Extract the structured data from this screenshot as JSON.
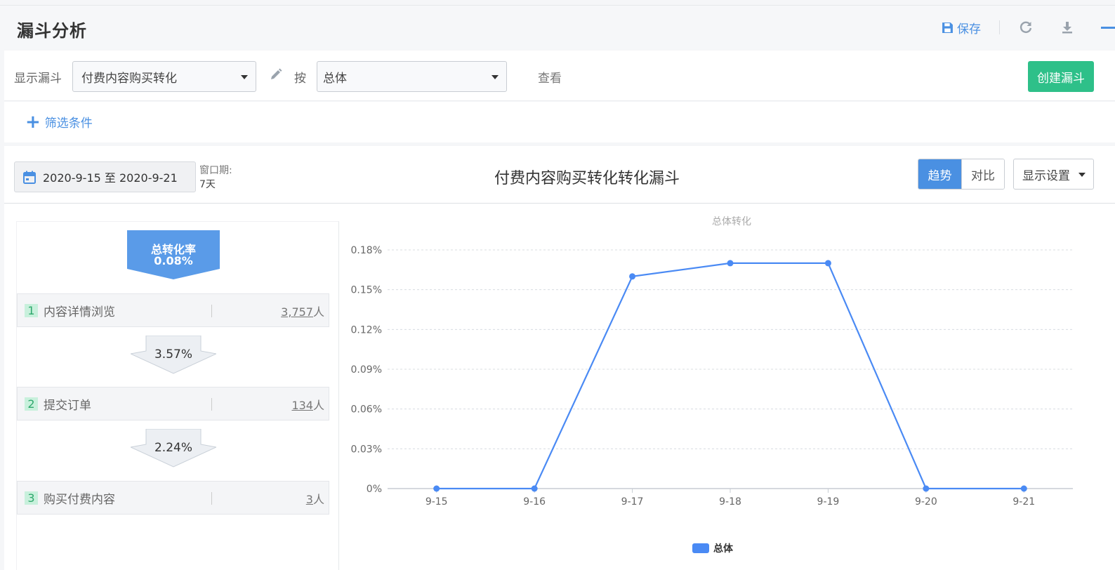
{
  "header": {
    "title": "漏斗分析",
    "save_label": "保存"
  },
  "toolbar": {
    "show_funnel_label": "显示漏斗",
    "funnel_select_value": "付费内容购买转化",
    "by_label": "按",
    "group_select_value": "总体",
    "view_label": "查看",
    "create_button": "创建漏斗"
  },
  "filter": {
    "add_label": "筛选条件"
  },
  "main": {
    "date_range": "2020-9-15 至 2020-9-21",
    "window_label": "窗口期:",
    "window_value": "7天",
    "funnel_title": "付费内容购买转化转化漏斗",
    "tabs": [
      {
        "label": "趋势",
        "active": true
      },
      {
        "label": "对比",
        "active": false
      }
    ],
    "display_settings": "显示设置"
  },
  "funnel": {
    "total_label": "总转化率",
    "total_rate": "0.08%",
    "steps": [
      {
        "num": "1",
        "name": "内容详情浏览",
        "count": "3,757",
        "unit": "人"
      },
      {
        "num": "2",
        "name": "提交订单",
        "count": "134",
        "unit": "人"
      },
      {
        "num": "3",
        "name": "购买付费内容",
        "count": "3",
        "unit": "人"
      }
    ],
    "step_rates": [
      "3.57%",
      "2.24%"
    ]
  },
  "colors": {
    "accent": "#4a90e2",
    "create_button": "#2ec089",
    "line": "#4a8af4"
  },
  "chart_data": {
    "type": "line",
    "title": "总体转化",
    "categories": [
      "9-15",
      "9-16",
      "9-17",
      "9-18",
      "9-19",
      "9-20",
      "9-21"
    ],
    "series": [
      {
        "name": "总体",
        "values": [
          0,
          0,
          0.16,
          0.17,
          0.17,
          0,
          0
        ]
      }
    ],
    "yticks": [
      "0%",
      "0.03%",
      "0.06%",
      "0.09%",
      "0.12%",
      "0.15%",
      "0.18%"
    ],
    "ylim": [
      0,
      0.18
    ],
    "grid": true,
    "legend": "bottom"
  }
}
